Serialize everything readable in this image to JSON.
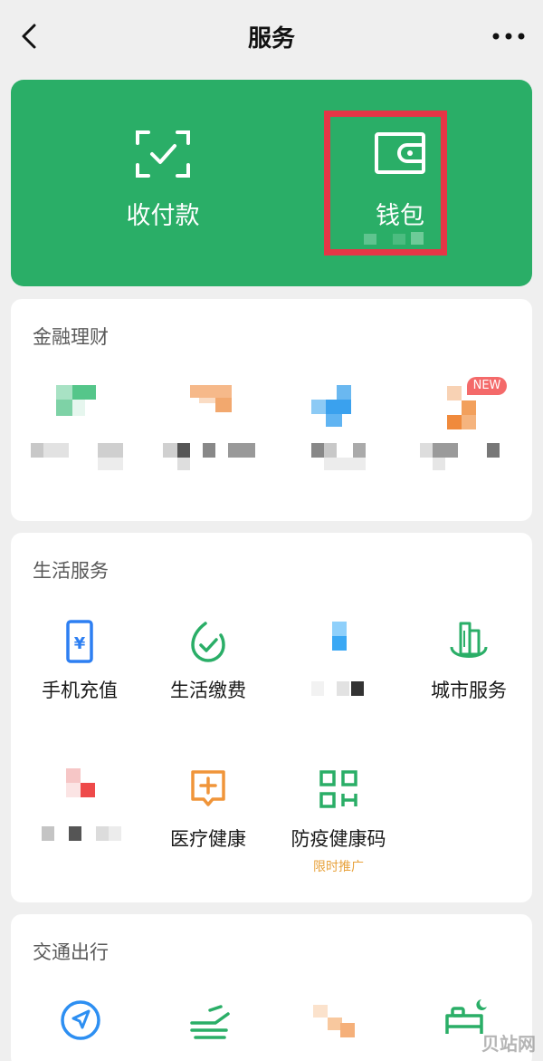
{
  "nav": {
    "title": "服务",
    "back_icon": "chevron-left-icon",
    "more_icon": "more-horizontal-icon"
  },
  "pay_card": {
    "color": "#2aae67",
    "collect": {
      "label": "收付款",
      "icon": "scan-check-icon"
    },
    "wallet": {
      "label": "钱包",
      "icon": "wallet-icon"
    },
    "highlight_color": "#e53646"
  },
  "finance": {
    "title": "金融理财",
    "badge": "NEW"
  },
  "life": {
    "title": "生活服务",
    "items": [
      {
        "label": "手机充值",
        "icon": "phone-recharge-icon"
      },
      {
        "label": "生活缴费",
        "icon": "utility-payment-icon"
      },
      {
        "label": "城市服务",
        "icon": "city-service-icon"
      },
      {
        "label": "医疗健康",
        "icon": "medical-health-icon"
      },
      {
        "label": "防疫健康码",
        "icon": "health-qr-code-icon",
        "sub": "限时推广"
      }
    ]
  },
  "transport": {
    "title": "交通出行"
  },
  "watermark": "贝站网"
}
